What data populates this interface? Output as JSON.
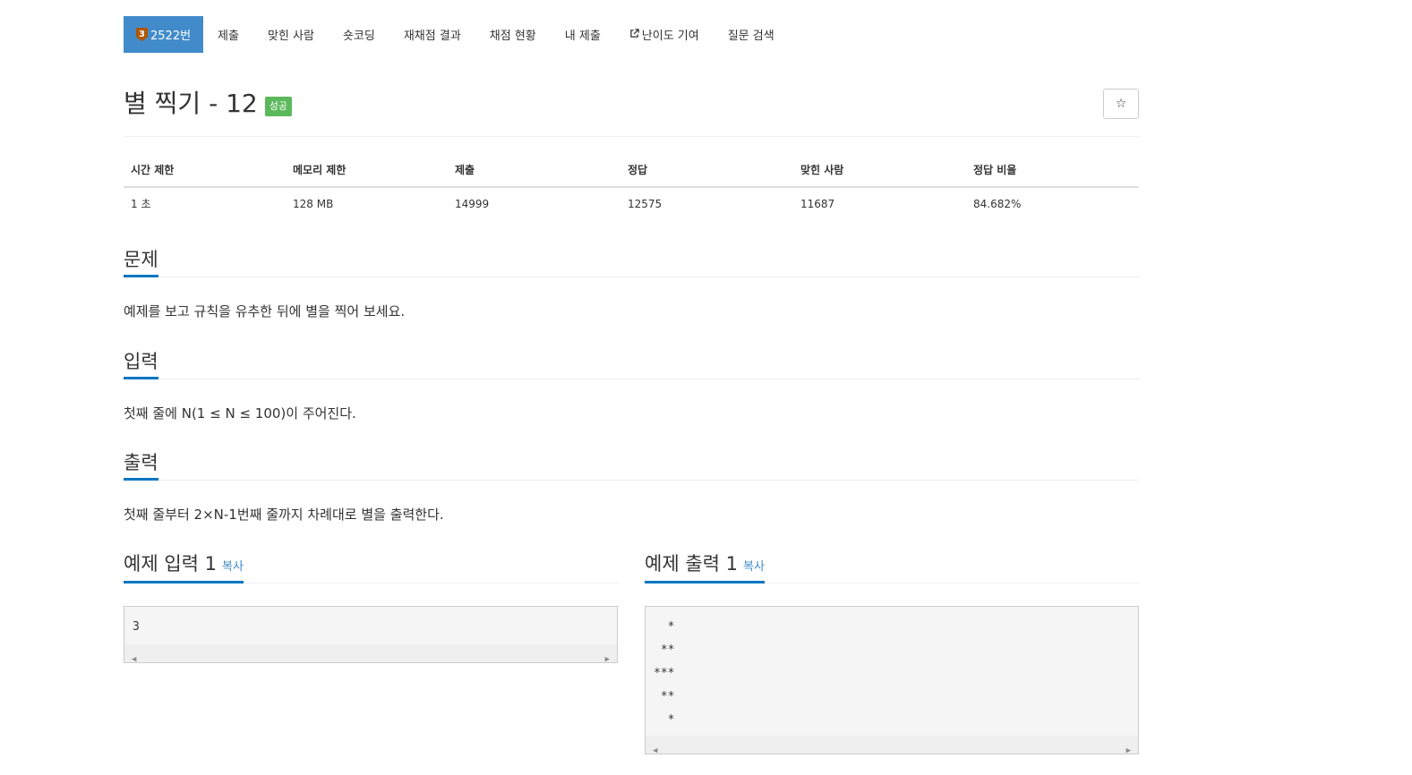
{
  "nav": {
    "tier": "3",
    "items": [
      {
        "label": "2522번",
        "active": true
      },
      {
        "label": "제출"
      },
      {
        "label": "맞힌 사람"
      },
      {
        "label": "숏코딩"
      },
      {
        "label": "재채점 결과"
      },
      {
        "label": "채점 현황"
      },
      {
        "label": "내 제출"
      },
      {
        "label": "난이도 기여",
        "icon": "external-link-icon"
      },
      {
        "label": "질문 검색"
      }
    ]
  },
  "problem": {
    "title": "별 찍기 - 12",
    "status_badge": "성공",
    "star_icon": "☆"
  },
  "info_table": {
    "headers": [
      "시간 제한",
      "메모리 제한",
      "제출",
      "정답",
      "맞힌 사람",
      "정답 비율"
    ],
    "row": [
      "1 초",
      "128 MB",
      "14999",
      "12575",
      "11687",
      "84.682%"
    ]
  },
  "sections": {
    "problem": {
      "title": "문제",
      "body": "예제를 보고 규칙을 유추한 뒤에 별을 찍어 보세요."
    },
    "input": {
      "title": "입력",
      "body": "첫째 줄에 N(1 ≤ N ≤ 100)이 주어진다."
    },
    "output": {
      "title": "출력",
      "body": "첫째 줄부터 2×N-1번째 줄까지 차례대로 별을 출력한다."
    }
  },
  "samples": {
    "input": {
      "title": "예제 입력 1",
      "copy_label": "복사",
      "content": "3"
    },
    "output": {
      "title": "예제 출력 1",
      "copy_label": "복사",
      "content": "  *\n **\n***\n **\n  *"
    }
  },
  "colors": {
    "nav_active": "#428bca",
    "tier_bronze": "#ad5600",
    "success": "#5cb85c",
    "section_underline": "#0076c0",
    "link": "#428bca"
  }
}
